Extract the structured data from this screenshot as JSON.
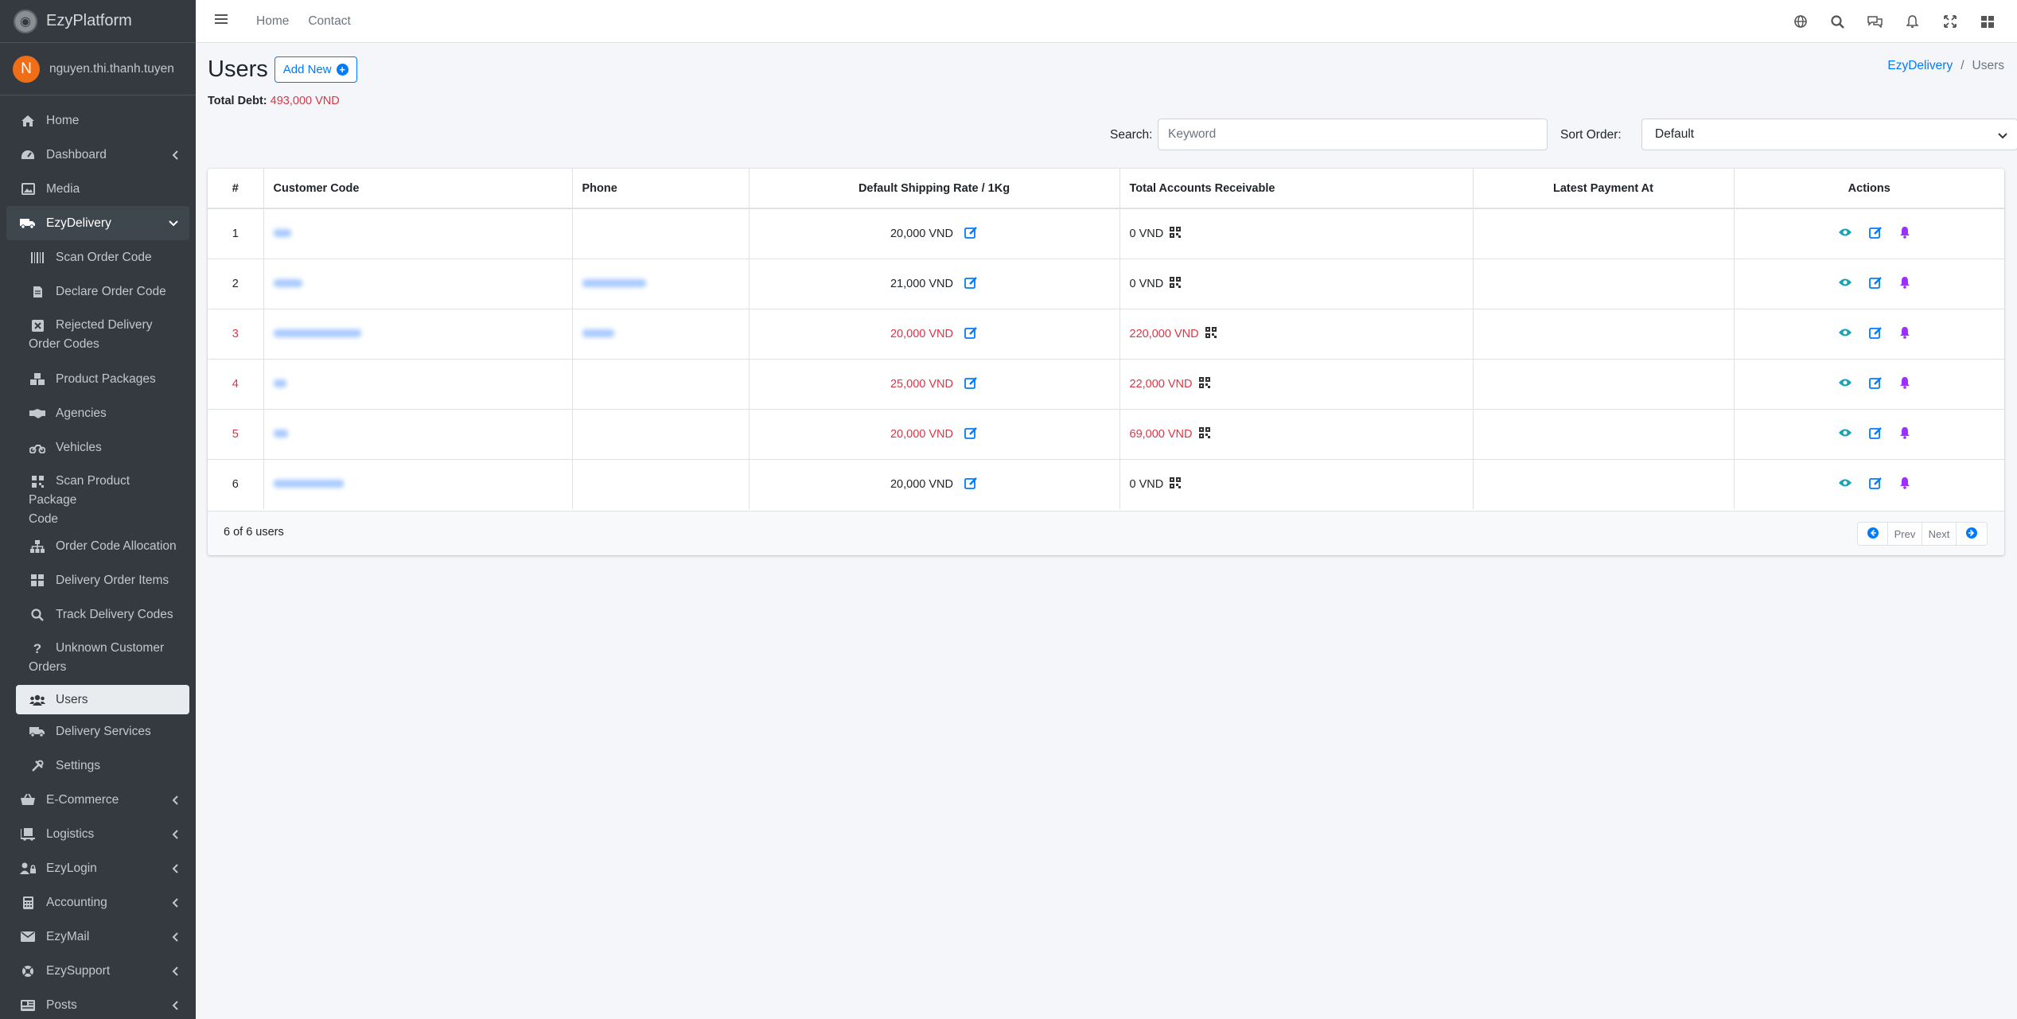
{
  "app": {
    "brand": "EzyPlatform",
    "user_initial": "N",
    "user_name": "nguyen.thi.thanh.tuyen"
  },
  "topbar": {
    "links": [
      "Home",
      "Contact"
    ]
  },
  "sidebar": {
    "home": "Home",
    "dashboard": "Dashboard",
    "media": "Media",
    "ezydelivery": "EzyDelivery",
    "sub": {
      "scan_order_code": "Scan Order Code",
      "declare_order_code": "Declare Order Code",
      "rejected_line1": "Rejected Delivery",
      "rejected_line2": "Order Codes",
      "product_packages": "Product Packages",
      "agencies": "Agencies",
      "vehicles": "Vehicles",
      "scan_pkg_line1": "Scan Product Package",
      "scan_pkg_line2": "Code",
      "order_code_allocation": "Order Code Allocation",
      "delivery_order_items": "Delivery Order Items",
      "track_delivery_codes": "Track Delivery Codes",
      "unknown_line1": "Unknown Customer",
      "unknown_line2": "Orders",
      "users": "Users",
      "delivery_services": "Delivery Services",
      "settings": "Settings"
    },
    "ecommerce": "E-Commerce",
    "logistics": "Logistics",
    "ezylogin": "EzyLogin",
    "accounting": "Accounting",
    "ezymail": "EzyMail",
    "ezysupport": "EzySupport",
    "posts": "Posts"
  },
  "page": {
    "title": "Users",
    "add_new": "Add New",
    "breadcrumb_parent": "EzyDelivery",
    "breadcrumb_sep": "/",
    "breadcrumb_current": "Users",
    "total_debt_label": "Total Debt:",
    "total_debt_value": "493,000 VND",
    "search_label": "Search:",
    "search_placeholder": "Keyword",
    "sort_label": "Sort Order:",
    "sort_value": "Default"
  },
  "table": {
    "headers": [
      "#",
      "Customer Code",
      "Phone",
      "Default Shipping Rate / 1Kg",
      "Total Accounts Receivable",
      "Latest Payment At",
      "Actions"
    ],
    "rows": [
      {
        "num": "1",
        "rate": "20,000 VND",
        "receivable": "0 VND",
        "highlight": false
      },
      {
        "num": "2",
        "rate": "21,000 VND",
        "receivable": "0 VND",
        "highlight": false
      },
      {
        "num": "3",
        "rate": "20,000 VND",
        "receivable": "220,000 VND",
        "highlight": true
      },
      {
        "num": "4",
        "rate": "25,000 VND",
        "receivable": "22,000 VND",
        "highlight": true
      },
      {
        "num": "5",
        "rate": "20,000 VND",
        "receivable": "69,000 VND",
        "highlight": true
      },
      {
        "num": "6",
        "rate": "20,000 VND",
        "receivable": "0 VND",
        "highlight": false
      }
    ],
    "footer": "6 of 6 users",
    "prev": "Prev",
    "next": "Next"
  },
  "colors": {
    "accent": "#007bff",
    "danger": "#dc3545",
    "sidebar": "#343a40",
    "view_icon": "#17a2b8",
    "bell_icon": "#9b30ff"
  }
}
